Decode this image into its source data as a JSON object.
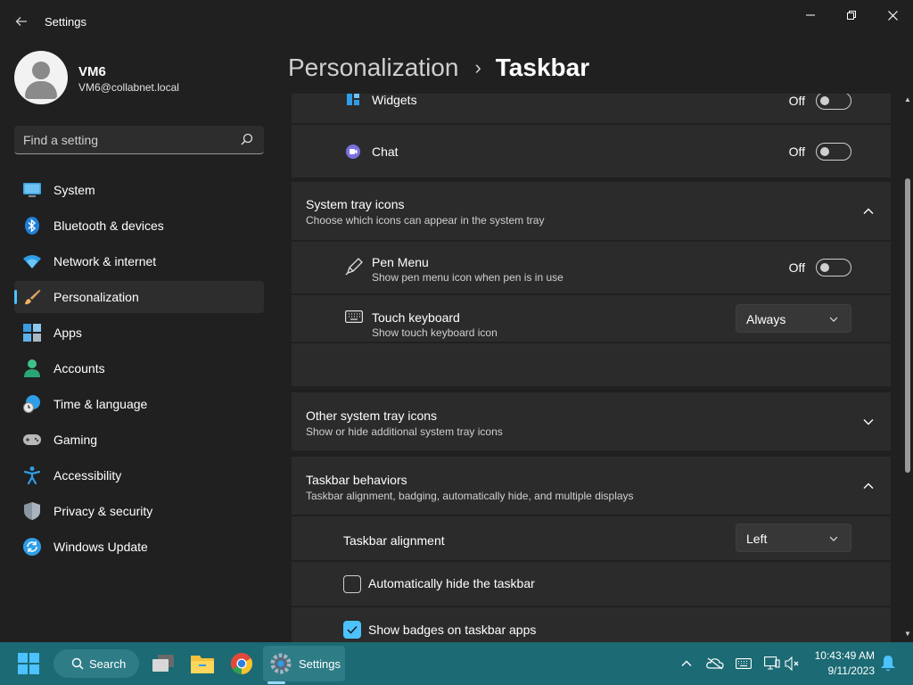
{
  "window": {
    "title": "Settings",
    "back_icon": "back-arrow-icon",
    "controls": [
      "minimize-icon",
      "restore-icon",
      "close-icon"
    ]
  },
  "profile": {
    "name": "VM6",
    "email": "VM6@collabnet.local"
  },
  "search": {
    "placeholder": "Find a setting"
  },
  "nav": {
    "items": [
      {
        "label": "System",
        "icon": "system-monitor-icon"
      },
      {
        "label": "Bluetooth & devices",
        "icon": "bluetooth-icon"
      },
      {
        "label": "Network & internet",
        "icon": "wifi-icon"
      },
      {
        "label": "Personalization",
        "icon": "paintbrush-icon",
        "active": true
      },
      {
        "label": "Apps",
        "icon": "apps-icon"
      },
      {
        "label": "Accounts",
        "icon": "person-icon"
      },
      {
        "label": "Time & language",
        "icon": "globe-clock-icon"
      },
      {
        "label": "Gaming",
        "icon": "gamepad-icon"
      },
      {
        "label": "Accessibility",
        "icon": "accessibility-icon"
      },
      {
        "label": "Privacy & security",
        "icon": "shield-icon"
      },
      {
        "label": "Windows Update",
        "icon": "update-icon"
      }
    ]
  },
  "header": {
    "parent": "Personalization",
    "separator": "›",
    "current": "Taskbar"
  },
  "taskbar_items": {
    "widgets": {
      "label": "Widgets",
      "state": "Off"
    },
    "chat": {
      "label": "Chat",
      "state": "Off"
    }
  },
  "system_tray": {
    "title": "System tray icons",
    "description": "Choose which icons can appear in the system tray",
    "pen_menu": {
      "label": "Pen Menu",
      "description": "Show pen menu icon when pen is in use",
      "state": "Off"
    },
    "touch_keyboard": {
      "label": "Touch keyboard",
      "description": "Show touch keyboard icon",
      "value": "Always"
    }
  },
  "other_tray": {
    "title": "Other system tray icons",
    "description": "Show or hide additional system tray icons"
  },
  "behaviors": {
    "title": "Taskbar behaviors",
    "description": "Taskbar alignment, badging, automatically hide, and multiple displays",
    "alignment": {
      "label": "Taskbar alignment",
      "value": "Left"
    },
    "auto_hide": {
      "label": "Automatically hide the taskbar",
      "checked": false
    },
    "badges": {
      "label": "Show badges on taskbar apps",
      "checked": true
    }
  },
  "taskbar": {
    "search_label": "Search",
    "settings_label": "Settings",
    "time": "10:43:49 AM",
    "date": "9/11/2023",
    "color": "#1b6a74"
  },
  "colors": {
    "accent": "#4cc2ff",
    "background": "#202020",
    "card": "#2b2b2b"
  }
}
